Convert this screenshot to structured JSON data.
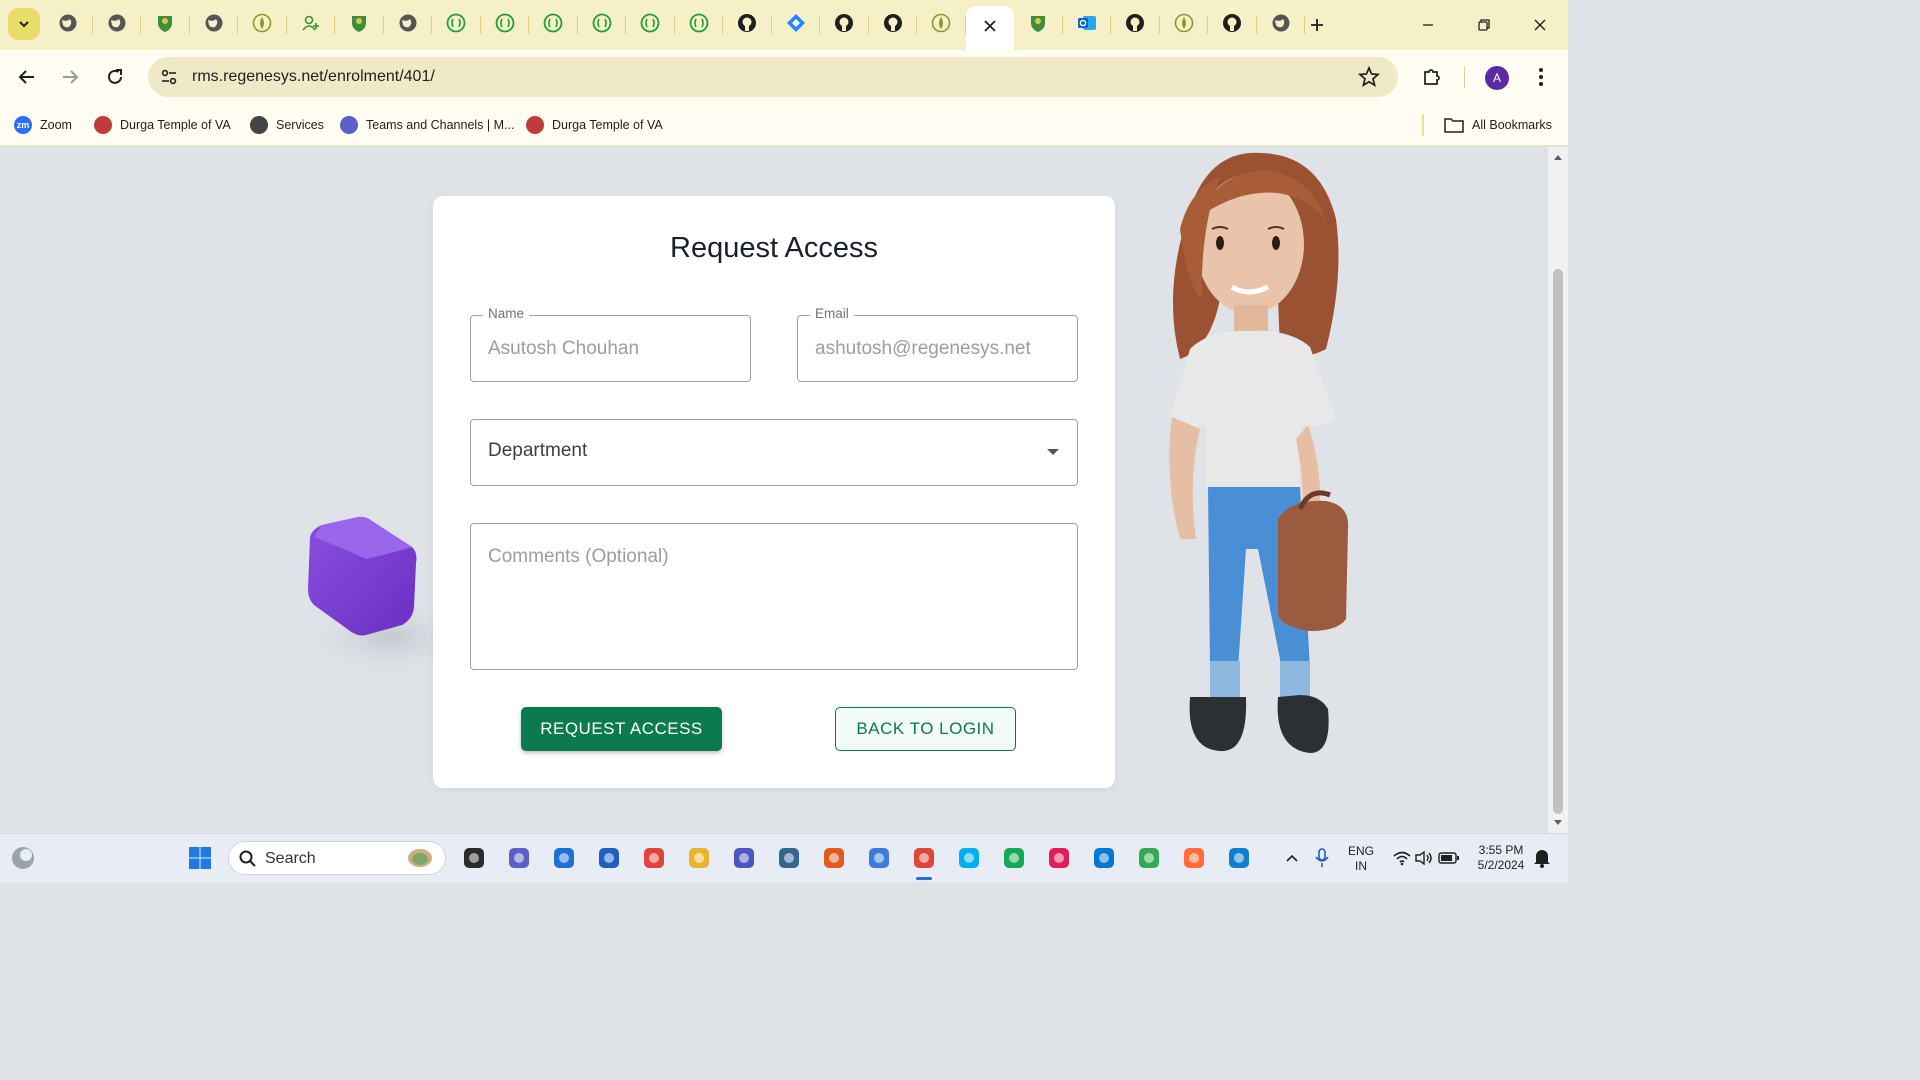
{
  "browser": {
    "tabs": [
      {
        "icon": "globe-icon",
        "color": "#555555"
      },
      {
        "icon": "globe-icon",
        "color": "#555555"
      },
      {
        "icon": "crest-icon",
        "color": "#3c8f3c"
      },
      {
        "icon": "globe-icon",
        "color": "#555555"
      },
      {
        "icon": "lotus-icon",
        "color": "#8a9a2a"
      },
      {
        "icon": "user-plus-icon",
        "color": "#3c8f3c"
      },
      {
        "icon": "crest-icon",
        "color": "#3c8f3c"
      },
      {
        "icon": "globe-icon",
        "color": "#555555"
      },
      {
        "icon": "api-icon",
        "color": "#1f9d3a"
      },
      {
        "icon": "api-icon",
        "color": "#1f9d3a"
      },
      {
        "icon": "api-icon",
        "color": "#1f9d3a"
      },
      {
        "icon": "api-icon",
        "color": "#1f9d3a"
      },
      {
        "icon": "api-icon",
        "color": "#1f9d3a"
      },
      {
        "icon": "api-icon",
        "color": "#1f9d3a"
      },
      {
        "icon": "github-icon",
        "color": "#1f1f1f"
      },
      {
        "icon": "jira-icon",
        "color": "#2684ff"
      },
      {
        "icon": "github-icon",
        "color": "#1f1f1f"
      },
      {
        "icon": "github-icon",
        "color": "#1f1f1f"
      },
      {
        "icon": "lotus-icon",
        "color": "#8a9a2a"
      },
      {
        "icon": "close-icon",
        "color": "#1f1f1f",
        "active": true
      },
      {
        "icon": "crest-icon",
        "color": "#3c8f3c"
      },
      {
        "icon": "outlook-icon",
        "color": "#0a64c8"
      },
      {
        "icon": "github-icon",
        "color": "#1f1f1f"
      },
      {
        "icon": "lotus-icon",
        "color": "#8a9a2a"
      },
      {
        "icon": "github-icon",
        "color": "#1f1f1f"
      },
      {
        "icon": "openai-icon",
        "color": "#555555"
      }
    ],
    "url": "rms.regenesys.net/enrolment/401/",
    "profile_initial": "A",
    "bookmarks": [
      {
        "label": "Zoom",
        "icon": "zoom-icon",
        "color": "#2d6cff"
      },
      {
        "label": "Durga Temple of VA",
        "icon": "temple-icon",
        "color": "#c23b3b"
      },
      {
        "label": "Services",
        "icon": "globe-icon",
        "color": "#444444"
      },
      {
        "label": "Teams and Channels | M...",
        "icon": "teams-icon",
        "color": "#5b5fc7"
      },
      {
        "label": "Durga Temple of VA",
        "icon": "temple-icon",
        "color": "#c23b3b"
      }
    ],
    "all_bookmarks": "All Bookmarks"
  },
  "form": {
    "title": "Request Access",
    "name_label": "Name",
    "name_value": "Asutosh Chouhan",
    "email_label": "Email",
    "email_value": "ashutosh@regenesys.net",
    "department_label": "Department",
    "comments_placeholder": "Comments (Optional)",
    "request_button": "REQUEST ACCESS",
    "back_button": "BACK TO LOGIN"
  },
  "taskbar": {
    "search_label": "Search",
    "language": "ENG",
    "region": "IN",
    "time": "3:55 PM",
    "date": "5/2/2024"
  },
  "colors": {
    "primary": "#0b7a4e",
    "tab_strip": "#f6f0c8",
    "page_bg": "#dfe3e8"
  }
}
